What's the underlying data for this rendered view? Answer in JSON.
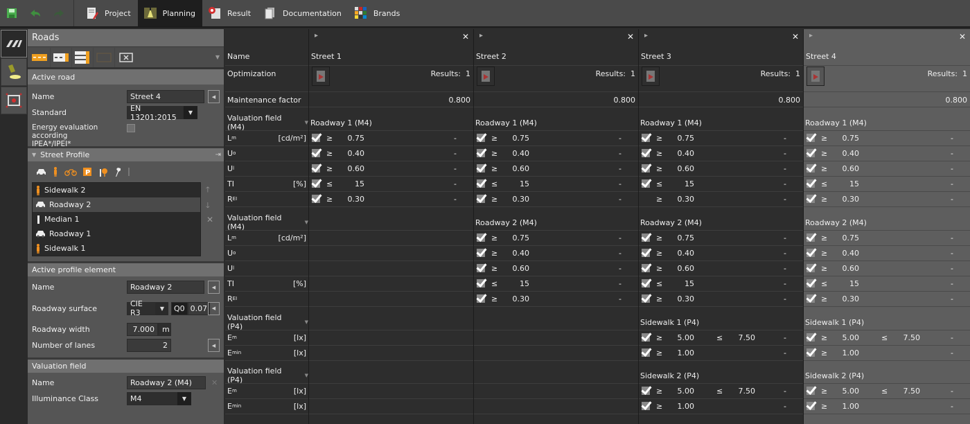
{
  "toolbar": {
    "quick_actions": [
      {
        "name": "save",
        "icon": "save-icon"
      },
      {
        "name": "undo",
        "icon": "undo-icon"
      },
      {
        "name": "redo",
        "icon": "redo-icon"
      }
    ],
    "tabs": [
      {
        "label": "Project",
        "icon": "project-icon",
        "active": false
      },
      {
        "label": "Planning",
        "icon": "planning-icon",
        "active": true
      },
      {
        "label": "Result",
        "icon": "result-icon",
        "active": false
      },
      {
        "label": "Documentation",
        "icon": "documentation-icon",
        "active": false
      },
      {
        "label": "Brands",
        "icon": "brands-icon",
        "active": false
      }
    ]
  },
  "side_strip": [
    {
      "icon": "roads-icon",
      "active": true
    },
    {
      "icon": "luminaire-icon",
      "active": false
    },
    {
      "icon": "valuation-field-icon",
      "active": false
    }
  ],
  "left_panel": {
    "title": "Roads",
    "tools": [
      "add-road-icon",
      "add-road-variant-icon",
      "add-road-multilane-icon",
      "disabled-road-icon",
      "delete-road-icon"
    ],
    "active_road": {
      "header": "Active road",
      "name_label": "Name",
      "name_value": "Street 4",
      "standard_label": "Standard",
      "standard_value": "EN 13201:2015",
      "energy_label_1": "Energy evaluation according",
      "energy_label_2": "IPEA*/IPEI*",
      "energy_checked": false
    },
    "street_profile": {
      "header": "Street Profile",
      "tools": [
        "car-icon",
        "pedestrian-icon",
        "bicycle-icon",
        "parking-icon",
        "tree-icon",
        "wrench-icon",
        "median-icon"
      ],
      "items": [
        {
          "label": "Sidewalk 2",
          "icon": "pedestrian-icon",
          "selected": false
        },
        {
          "label": "Roadway 2",
          "icon": "car-icon",
          "selected": true
        },
        {
          "label": "Median 1",
          "icon": "median-icon",
          "selected": false
        },
        {
          "label": "Roadway 1",
          "icon": "car-icon",
          "selected": false
        },
        {
          "label": "Sidewalk 1",
          "icon": "pedestrian-icon",
          "selected": false
        }
      ]
    },
    "active_profile_element": {
      "header": "Active profile element",
      "name_label": "Name",
      "name_value": "Roadway 2",
      "surface_label": "Roadway surface",
      "surface_value": "CIE R3",
      "q0_label": "Q0",
      "q0_value": "0.07",
      "width_label": "Roadway width",
      "width_value": "7.000",
      "width_unit": "m",
      "lanes_label": "Number of lanes",
      "lanes_value": "2"
    },
    "valuation_field": {
      "header": "Valuation field",
      "name_label": "Name",
      "name_value": "Roadway 2 (M4)",
      "class_label": "Illuminance Class",
      "class_value": "M4"
    }
  },
  "grid": {
    "labels": {
      "name": "Name",
      "optimization": "Optimization",
      "maintenance": "Maintenance factor",
      "groups": [
        {
          "title": "Valuation field (M4)",
          "rows": [
            {
              "l": "L",
              "sub": "m",
              "u": "[cd/m²]"
            },
            {
              "l": "U",
              "sub": "o",
              "u": ""
            },
            {
              "l": "U",
              "sub": "l",
              "u": ""
            },
            {
              "l": "TI",
              "sub": "",
              "u": "[%]"
            },
            {
              "l": "R",
              "sub": "EI",
              "u": ""
            }
          ]
        },
        {
          "title": "Valuation field (M4)",
          "rows": [
            {
              "l": "L",
              "sub": "m",
              "u": "[cd/m²]"
            },
            {
              "l": "U",
              "sub": "o",
              "u": ""
            },
            {
              "l": "U",
              "sub": "l",
              "u": ""
            },
            {
              "l": "TI",
              "sub": "",
              "u": "[%]"
            },
            {
              "l": "R",
              "sub": "EI",
              "u": ""
            }
          ]
        },
        {
          "title": "Valuation field (P4)",
          "rows": [
            {
              "l": "E",
              "sub": "m",
              "u": "[lx]"
            },
            {
              "l": "E",
              "sub": "min",
              "u": "[lx]"
            }
          ]
        },
        {
          "title": "Valuation field (P4)",
          "rows": [
            {
              "l": "E",
              "sub": "m",
              "u": "[lx]"
            },
            {
              "l": "E",
              "sub": "min",
              "u": "[lx]"
            }
          ]
        }
      ]
    },
    "streets": [
      {
        "name": "Street 1",
        "results": "Results:  1",
        "maintenance": "0.800",
        "active": false,
        "groups": [
          {
            "title": "Roadway 1 (M4)",
            "rows": [
              {
                "check": true,
                "op": "≥",
                "v": "0.75",
                "op2": "",
                "v2": "",
                "res": "-"
              },
              {
                "check": true,
                "op": "≥",
                "v": "0.40",
                "op2": "",
                "v2": "",
                "res": "-"
              },
              {
                "check": true,
                "op": "≥",
                "v": "0.60",
                "op2": "",
                "v2": "",
                "res": "-"
              },
              {
                "check": true,
                "op": "≤",
                "v": "15",
                "op2": "",
                "v2": "",
                "res": "-"
              },
              {
                "check": true,
                "op": "≥",
                "v": "0.30",
                "op2": "",
                "v2": "",
                "res": "-"
              }
            ]
          },
          null,
          null,
          null
        ]
      },
      {
        "name": "Street 2",
        "results": "Results:  1",
        "maintenance": "0.800",
        "active": false,
        "groups": [
          {
            "title": "Roadway 1 (M4)",
            "rows": [
              {
                "check": true,
                "op": "≥",
                "v": "0.75",
                "res": "-"
              },
              {
                "check": true,
                "op": "≥",
                "v": "0.40",
                "res": "-"
              },
              {
                "check": true,
                "op": "≥",
                "v": "0.60",
                "res": "-"
              },
              {
                "check": true,
                "op": "≤",
                "v": "15",
                "res": "-"
              },
              {
                "check": true,
                "op": "≥",
                "v": "0.30",
                "res": "-"
              }
            ]
          },
          {
            "title": "Roadway 2 (M4)",
            "rows": [
              {
                "check": true,
                "op": "≥",
                "v": "0.75",
                "res": "-"
              },
              {
                "check": true,
                "op": "≥",
                "v": "0.40",
                "res": "-"
              },
              {
                "check": true,
                "op": "≥",
                "v": "0.60",
                "res": "-"
              },
              {
                "check": true,
                "op": "≤",
                "v": "15",
                "res": "-"
              },
              {
                "check": true,
                "op": "≥",
                "v": "0.30",
                "res": "-"
              }
            ]
          },
          null,
          null
        ]
      },
      {
        "name": "Street 3",
        "results": "Results:  1",
        "maintenance": "0.800",
        "active": false,
        "groups": [
          {
            "title": "Roadway 1 (M4)",
            "rows": [
              {
                "check": true,
                "op": "≥",
                "v": "0.75",
                "res": "-"
              },
              {
                "check": true,
                "op": "≥",
                "v": "0.40",
                "res": "-"
              },
              {
                "check": true,
                "op": "≥",
                "v": "0.60",
                "res": "-"
              },
              {
                "check": true,
                "op": "≤",
                "v": "15",
                "res": "-"
              },
              {
                "check": false,
                "op": "≥",
                "v": "0.30",
                "res": "-"
              }
            ]
          },
          {
            "title": "Roadway 2 (M4)",
            "rows": [
              {
                "check": true,
                "op": "≥",
                "v": "0.75",
                "res": "-"
              },
              {
                "check": true,
                "op": "≥",
                "v": "0.40",
                "res": "-"
              },
              {
                "check": true,
                "op": "≥",
                "v": "0.60",
                "res": "-"
              },
              {
                "check": true,
                "op": "≤",
                "v": "15",
                "res": "-"
              },
              {
                "check": true,
                "op": "≥",
                "v": "0.30",
                "res": "-"
              }
            ]
          },
          {
            "title": "Sidewalk 1 (P4)",
            "rows": [
              {
                "check": true,
                "op": "≥",
                "v": "5.00",
                "op2": "≤",
                "v2": "7.50",
                "res": "-"
              },
              {
                "check": true,
                "op": "≥",
                "v": "1.00",
                "res": "-"
              }
            ]
          },
          {
            "title": "Sidewalk 2 (P4)",
            "rows": [
              {
                "check": true,
                "op": "≥",
                "v": "5.00",
                "op2": "≤",
                "v2": "7.50",
                "res": "-"
              },
              {
                "check": true,
                "op": "≥",
                "v": "1.00",
                "res": "-"
              }
            ]
          }
        ]
      },
      {
        "name": "Street 4",
        "results": "Results:  1",
        "maintenance": "0.800",
        "active": true,
        "groups": [
          {
            "title": "Roadway 1 (M4)",
            "rows": [
              {
                "check": true,
                "op": "≥",
                "v": "0.75",
                "res": "-"
              },
              {
                "check": true,
                "op": "≥",
                "v": "0.40",
                "res": "-"
              },
              {
                "check": true,
                "op": "≥",
                "v": "0.60",
                "res": "-"
              },
              {
                "check": true,
                "op": "≤",
                "v": "15",
                "res": "-"
              },
              {
                "check": true,
                "op": "≥",
                "v": "0.30",
                "res": "-"
              }
            ]
          },
          {
            "title": "Roadway 2 (M4)",
            "rows": [
              {
                "check": true,
                "op": "≥",
                "v": "0.75",
                "res": "-"
              },
              {
                "check": true,
                "op": "≥",
                "v": "0.40",
                "res": "-"
              },
              {
                "check": true,
                "op": "≥",
                "v": "0.60",
                "res": "-"
              },
              {
                "check": true,
                "op": "≤",
                "v": "15",
                "res": "-"
              },
              {
                "check": true,
                "op": "≥",
                "v": "0.30",
                "res": "-"
              }
            ]
          },
          {
            "title": "Sidewalk 1 (P4)",
            "rows": [
              {
                "check": true,
                "op": "≥",
                "v": "5.00",
                "op2": "≤",
                "v2": "7.50",
                "res": "-"
              },
              {
                "check": true,
                "op": "≥",
                "v": "1.00",
                "res": "-"
              }
            ]
          },
          {
            "title": "Sidewalk 2 (P4)",
            "rows": [
              {
                "check": true,
                "op": "≥",
                "v": "5.00",
                "op2": "≤",
                "v2": "7.50",
                "res": "-"
              },
              {
                "check": true,
                "op": "≥",
                "v": "1.00",
                "res": "-"
              }
            ]
          }
        ]
      }
    ]
  }
}
